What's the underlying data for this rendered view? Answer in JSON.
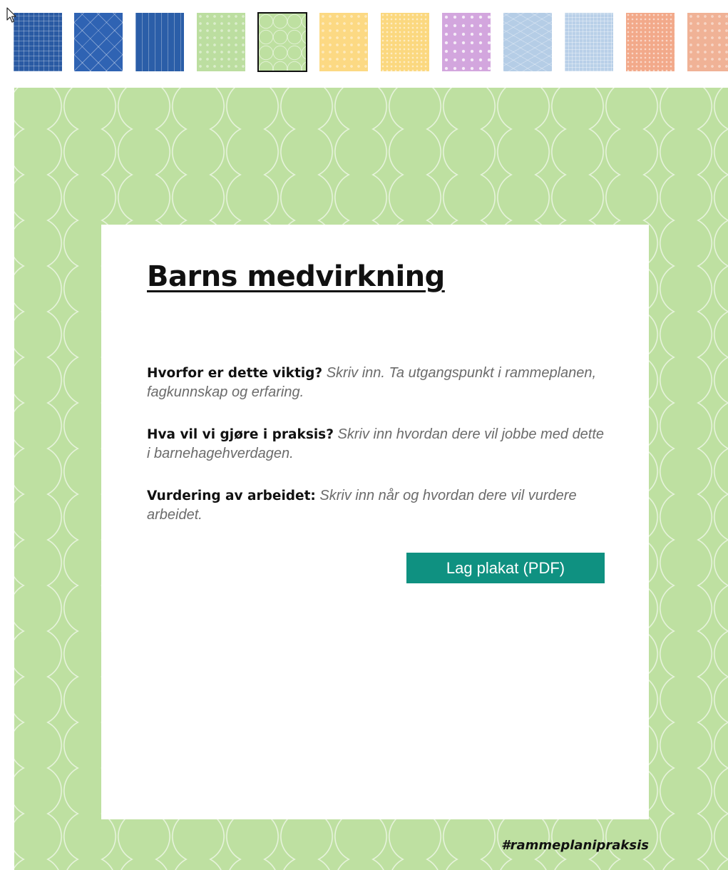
{
  "swatches": [
    {
      "name": "swatch-dark-blue-grid",
      "color": "#2a5aa3",
      "pattern": "grid"
    },
    {
      "name": "swatch-blue-diamond",
      "color": "#2f63b3",
      "pattern": "diamond"
    },
    {
      "name": "swatch-blue-stripes",
      "color": "#2b5ea8",
      "pattern": "vertical-stripes"
    },
    {
      "name": "swatch-light-green-dots",
      "color": "#bcdea0",
      "pattern": "soft-dots"
    },
    {
      "name": "swatch-green-circles",
      "color": "#bee0a1",
      "pattern": "circles",
      "selected": true
    },
    {
      "name": "swatch-yellow-plain",
      "color": "#fcd983",
      "pattern": "soft-dots"
    },
    {
      "name": "swatch-yellow-dots",
      "color": "#fbd87f",
      "pattern": "small-dots"
    },
    {
      "name": "swatch-lilac-dots",
      "color": "#d3a6de",
      "pattern": "big-dots"
    },
    {
      "name": "swatch-light-blue-waves",
      "color": "#b5cde6",
      "pattern": "waves"
    },
    {
      "name": "swatch-light-blue-grid",
      "color": "#b9d0e8",
      "pattern": "fine-grid"
    },
    {
      "name": "swatch-salmon-dots",
      "color": "#f2a98a",
      "pattern": "small-dots"
    },
    {
      "name": "swatch-salmon-plain",
      "color": "#f0b296",
      "pattern": "soft-dots"
    }
  ],
  "colors": {
    "poster_background": "#bee0a1",
    "button": "#0f9181",
    "button_text": "#ffffff"
  },
  "poster": {
    "title": "Barns medvirkning",
    "sections": [
      {
        "label": "Hvorfor er dette viktig?",
        "text": "Skriv inn. Ta utgangspunkt i rammeplanen, fagkunnskap og erfaring."
      },
      {
        "label": "Hva vil vi gjøre i praksis?",
        "text": "Skriv inn hvordan dere vil jobbe med dette i barnehagehverdagen."
      },
      {
        "label": "Vurdering av arbeidet:",
        "text": "Skriv inn når og hvordan dere vil vurdere arbeidet."
      }
    ],
    "button_label": "Lag plakat (PDF)",
    "hashtag": "#rammeplanipraksis"
  },
  "icons": {
    "cursor": "mouse-pointer-icon"
  }
}
